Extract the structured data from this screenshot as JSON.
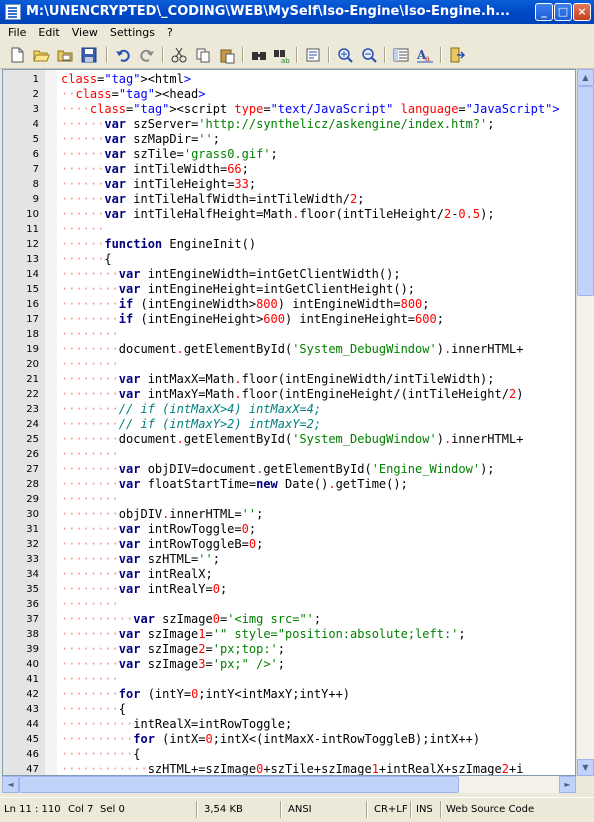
{
  "window": {
    "title": "M:\\UNENCRYPTED\\_CODING\\WEB\\MySelf\\Iso-Engine\\Iso-Engine.h...",
    "minimize": "_",
    "maximize": "□",
    "close": "×"
  },
  "menu": [
    "File",
    "Edit",
    "View",
    "Settings",
    "?"
  ],
  "toolbar_icons": [
    "new-file-icon",
    "open-file-icon",
    "open-folder-icon",
    "save-icon",
    "undo-icon",
    "redo-icon",
    "cut-icon",
    "copy-icon",
    "paste-icon",
    "find-icon",
    "replace-icon",
    "settings-icon",
    "zoom-in-icon",
    "zoom-out-icon",
    "line-numbers-icon",
    "font-icon",
    "exit-icon"
  ],
  "code_lines": [
    {
      "n": "1",
      "t": "<html>"
    },
    {
      "n": "2",
      "t": "··<head>"
    },
    {
      "n": "3",
      "t": "····<script type=\"text/JavaScript\" language=\"JavaScript\">"
    },
    {
      "n": "4",
      "t": "······var szServer='http://synthelicz/askengine/index.htm?';"
    },
    {
      "n": "5",
      "t": "······var szMapDir='';"
    },
    {
      "n": "6",
      "t": "······var szTile='grass0.gif';"
    },
    {
      "n": "7",
      "t": "······var intTileWidth=66;"
    },
    {
      "n": "8",
      "t": "······var intTileHeight=33;"
    },
    {
      "n": "9",
      "t": "······var intTileHalfWidth=intTileWidth/2;"
    },
    {
      "n": "10",
      "t": "······var intTileHalfHeight=Math.floor(intTileHeight/2-0.5);"
    },
    {
      "n": "11",
      "t": "······"
    },
    {
      "n": "12",
      "t": "······function EngineInit()"
    },
    {
      "n": "13",
      "t": "······{"
    },
    {
      "n": "14",
      "t": "········var intEngineWidth=intGetClientWidth();"
    },
    {
      "n": "15",
      "t": "········var intEngineHeight=intGetClientHeight();"
    },
    {
      "n": "16",
      "t": "········if (intEngineWidth>800) intEngineWidth=800;"
    },
    {
      "n": "17",
      "t": "········if (intEngineHeight>600) intEngineHeight=600;"
    },
    {
      "n": "18",
      "t": "········"
    },
    {
      "n": "19",
      "t": "········document.getElementById('System_DebugWindow').innerHTML+"
    },
    {
      "n": "20",
      "t": "········"
    },
    {
      "n": "21",
      "t": "········var intMaxX=Math.floor(intEngineWidth/intTileWidth);"
    },
    {
      "n": "22",
      "t": "········var intMaxY=Math.floor(intEngineHeight/(intTileHeight/2)"
    },
    {
      "n": "23",
      "t": "········// if (intMaxX>4) intMaxX=4;"
    },
    {
      "n": "24",
      "t": "········// if (intMaxY>2) intMaxY=2;"
    },
    {
      "n": "25",
      "t": "········document.getElementById('System_DebugWindow').innerHTML+"
    },
    {
      "n": "26",
      "t": "········"
    },
    {
      "n": "27",
      "t": "········var objDIV=document.getElementById('Engine_Window');"
    },
    {
      "n": "28",
      "t": "········var floatStartTime=new Date().getTime();"
    },
    {
      "n": "29",
      "t": "········"
    },
    {
      "n": "30",
      "t": "········objDIV.innerHTML='';"
    },
    {
      "n": "31",
      "t": "········var intRowToggle=0;"
    },
    {
      "n": "32",
      "t": "········var intRowToggleB=0;"
    },
    {
      "n": "33",
      "t": "········var szHTML='';"
    },
    {
      "n": "34",
      "t": "········var intRealX;"
    },
    {
      "n": "35",
      "t": "········var intRealY=0;"
    },
    {
      "n": "36",
      "t": "········"
    },
    {
      "n": "37",
      "t": "··········var szImage0='<img src=\"';"
    },
    {
      "n": "38",
      "t": "········var szImage1='\" style=\"position:absolute;left:';"
    },
    {
      "n": "39",
      "t": "········var szImage2='px;top:';"
    },
    {
      "n": "40",
      "t": "········var szImage3='px;\" />';"
    },
    {
      "n": "41",
      "t": "········"
    },
    {
      "n": "42",
      "t": "········for (intY=0;intY<intMaxY;intY++)"
    },
    {
      "n": "43",
      "t": "········{"
    },
    {
      "n": "44",
      "t": "··········intRealX=intRowToggle;"
    },
    {
      "n": "45",
      "t": "··········for (intX=0;intX<(intMaxX-intRowToggleB);intX++)"
    },
    {
      "n": "46",
      "t": "··········{"
    },
    {
      "n": "47",
      "t": "············szHTML+=szImage0+szTile+szImage1+intRealX+szImage2+i"
    }
  ],
  "status": {
    "position": "Ln 11 : 110",
    "col": "Col 7",
    "sel": "Sel 0",
    "size": "3,54 KB",
    "encoding": "ANSI",
    "eol": "CR+LF",
    "mode": "INS",
    "scheme": "Web Source Code"
  }
}
